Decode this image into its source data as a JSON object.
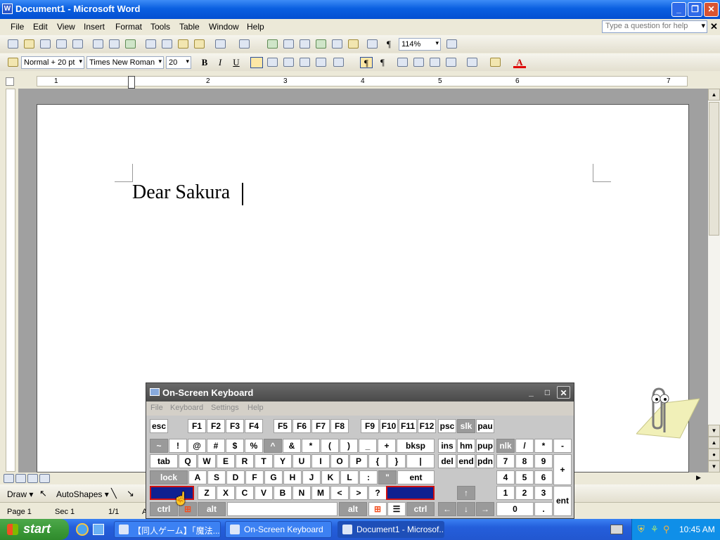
{
  "window": {
    "title": "Document1 - Microsoft Word",
    "minimize": "_",
    "restore": "❐",
    "close": "✕",
    "doc_close": "✕"
  },
  "menu": [
    "File",
    "Edit",
    "View",
    "Insert",
    "Format",
    "Tools",
    "Table",
    "Window",
    "Help"
  ],
  "help_box": {
    "placeholder": "Type a question for help",
    "arrow": "▾"
  },
  "toolbar": {
    "zoom": "114%",
    "style": "Normal + 20 pt",
    "font": "Times New Roman",
    "size": "20",
    "bold": "B",
    "italic": "I",
    "underline": "U",
    "dropdown": "▾",
    "pilcrow": "¶",
    "font_color": "A"
  },
  "ruler": {
    "numbers": [
      "1",
      "1",
      "2",
      "3",
      "4",
      "5",
      "6",
      "7"
    ]
  },
  "document": {
    "text": "Dear Sakura"
  },
  "drawbar": {
    "draw": "Draw ▾",
    "autoshapes": "AutoShapes ▾"
  },
  "status": {
    "page": "Page  1",
    "sec": "Sec  1",
    "pages": "1/1",
    "at": "A"
  },
  "taskbar": {
    "start": "start",
    "tasks": [
      "【同人ゲーム】「魔法...",
      "On-Screen Keyboard",
      "Document1 - Microsof..."
    ],
    "clock": "10:45 AM"
  },
  "osk": {
    "title": "On-Screen Keyboard",
    "menu": [
      "File",
      "Keyboard",
      "Settings",
      "Help"
    ],
    "row0": [
      "esc",
      "F1",
      "F2",
      "F3",
      "F4",
      "F5",
      "F6",
      "F7",
      "F8",
      "F9",
      "F10",
      "F11",
      "F12",
      "psc",
      "slk",
      "pau"
    ],
    "row1": [
      "~",
      "!",
      "@",
      "#",
      "$",
      "%",
      "^",
      "&",
      "*",
      "(",
      ")",
      "_",
      "+",
      "bksp",
      "ins",
      "hm",
      "pup",
      "nlk",
      "/",
      "*",
      "-"
    ],
    "row2": [
      "tab",
      "Q",
      "W",
      "E",
      "R",
      "T",
      "Y",
      "U",
      "I",
      "O",
      "P",
      "{",
      "}",
      "|",
      "del",
      "end",
      "pdn",
      "7",
      "8",
      "9"
    ],
    "row3": [
      "lock",
      "A",
      "S",
      "D",
      "F",
      "G",
      "H",
      "J",
      "K",
      "L",
      ":",
      "\"",
      "ent",
      "4",
      "5",
      "6"
    ],
    "row4": [
      "Z",
      "X",
      "C",
      "V",
      "B",
      "N",
      "M",
      "<",
      ">",
      "?",
      "↑",
      "1",
      "2",
      "3"
    ],
    "row5": [
      "ctrl",
      "alt",
      "alt",
      "ctrl",
      "←",
      "↓",
      "→",
      "0",
      "."
    ],
    "numplus": "+",
    "nument": "ent"
  }
}
